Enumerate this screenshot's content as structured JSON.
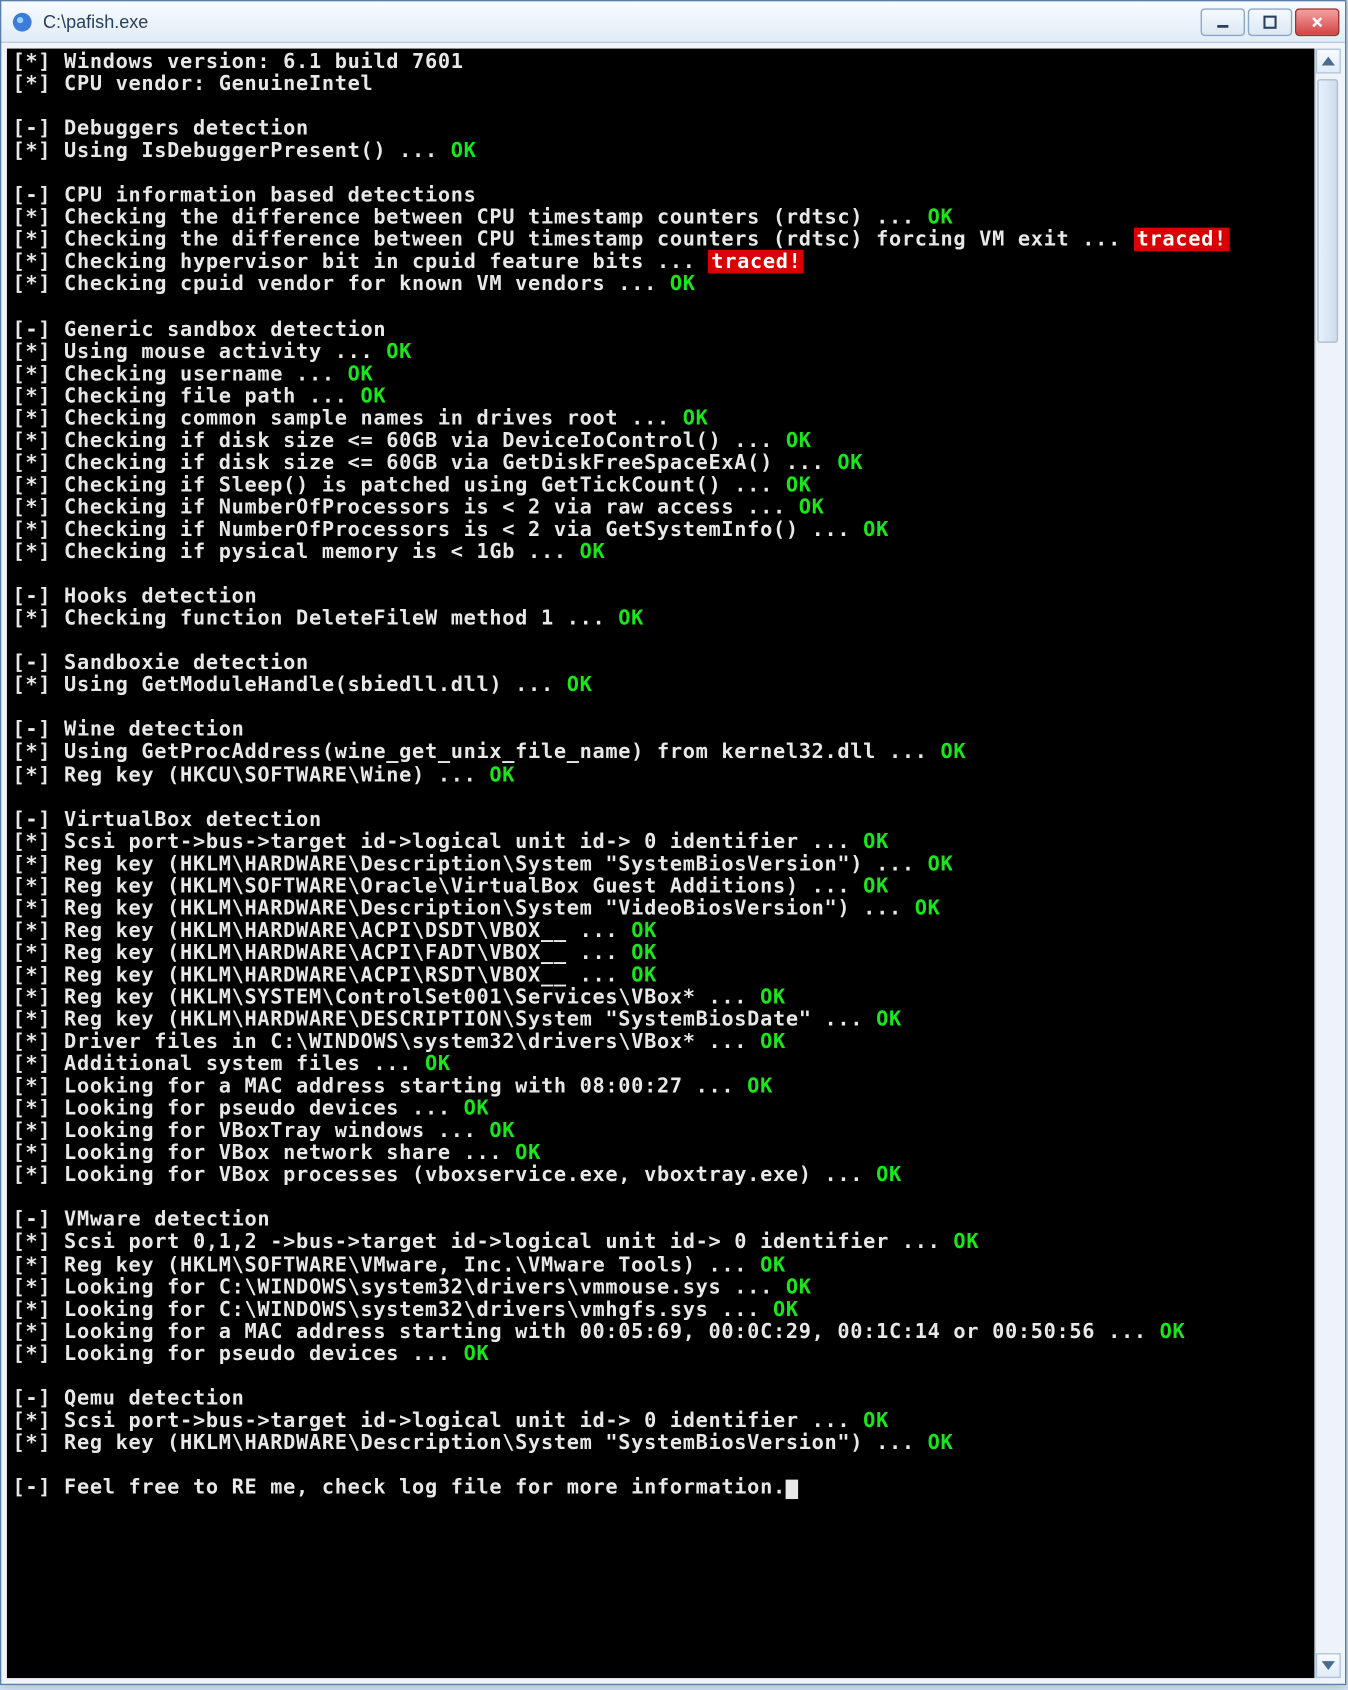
{
  "window": {
    "title": "C:\\pafish.exe"
  },
  "status": {
    "ok": "OK",
    "traced": "traced!"
  },
  "lines": [
    {
      "p": "[*] ",
      "t": "Windows version: 6.1 build 7601"
    },
    {
      "p": "[*] ",
      "t": "CPU vendor: GenuineIntel"
    },
    {
      "blank": true
    },
    {
      "p": "[-] ",
      "t": "Debuggers detection"
    },
    {
      "p": "[*] ",
      "t": "Using IsDebuggerPresent() ... ",
      "s": "ok"
    },
    {
      "blank": true
    },
    {
      "p": "[-] ",
      "t": "CPU information based detections"
    },
    {
      "p": "[*] ",
      "t": "Checking the difference between CPU timestamp counters (rdtsc) ... ",
      "s": "ok"
    },
    {
      "p": "[*] ",
      "t": "Checking the difference between CPU timestamp counters (rdtsc) forcing VM exit ... ",
      "s": "traced"
    },
    {
      "p": "[*] ",
      "t": "Checking hypervisor bit in cpuid feature bits ... ",
      "s": "traced"
    },
    {
      "p": "[*] ",
      "t": "Checking cpuid vendor for known VM vendors ... ",
      "s": "ok"
    },
    {
      "blank": true
    },
    {
      "p": "[-] ",
      "t": "Generic sandbox detection"
    },
    {
      "p": "[*] ",
      "t": "Using mouse activity ... ",
      "s": "ok"
    },
    {
      "p": "[*] ",
      "t": "Checking username ... ",
      "s": "ok"
    },
    {
      "p": "[*] ",
      "t": "Checking file path ... ",
      "s": "ok"
    },
    {
      "p": "[*] ",
      "t": "Checking common sample names in drives root ... ",
      "s": "ok"
    },
    {
      "p": "[*] ",
      "t": "Checking if disk size <= 60GB via DeviceIoControl() ... ",
      "s": "ok"
    },
    {
      "p": "[*] ",
      "t": "Checking if disk size <= 60GB via GetDiskFreeSpaceExA() ... ",
      "s": "ok"
    },
    {
      "p": "[*] ",
      "t": "Checking if Sleep() is patched using GetTickCount() ... ",
      "s": "ok"
    },
    {
      "p": "[*] ",
      "t": "Checking if NumberOfProcessors is < 2 via raw access ... ",
      "s": "ok"
    },
    {
      "p": "[*] ",
      "t": "Checking if NumberOfProcessors is < 2 via GetSystemInfo() ... ",
      "s": "ok"
    },
    {
      "p": "[*] ",
      "t": "Checking if pysical memory is < 1Gb ... ",
      "s": "ok"
    },
    {
      "blank": true
    },
    {
      "p": "[-] ",
      "t": "Hooks detection"
    },
    {
      "p": "[*] ",
      "t": "Checking function DeleteFileW method 1 ... ",
      "s": "ok"
    },
    {
      "blank": true
    },
    {
      "p": "[-] ",
      "t": "Sandboxie detection"
    },
    {
      "p": "[*] ",
      "t": "Using GetModuleHandle(sbiedll.dll) ... ",
      "s": "ok"
    },
    {
      "blank": true
    },
    {
      "p": "[-] ",
      "t": "Wine detection"
    },
    {
      "p": "[*] ",
      "t": "Using GetProcAddress(wine_get_unix_file_name) from kernel32.dll ... ",
      "s": "ok"
    },
    {
      "p": "[*] ",
      "t": "Reg key (HKCU\\SOFTWARE\\Wine) ... ",
      "s": "ok"
    },
    {
      "blank": true
    },
    {
      "p": "[-] ",
      "t": "VirtualBox detection"
    },
    {
      "p": "[*] ",
      "t": "Scsi port->bus->target id->logical unit id-> 0 identifier ... ",
      "s": "ok"
    },
    {
      "p": "[*] ",
      "t": "Reg key (HKLM\\HARDWARE\\Description\\System \"SystemBiosVersion\") ... ",
      "s": "ok"
    },
    {
      "p": "[*] ",
      "t": "Reg key (HKLM\\SOFTWARE\\Oracle\\VirtualBox Guest Additions) ... ",
      "s": "ok"
    },
    {
      "p": "[*] ",
      "t": "Reg key (HKLM\\HARDWARE\\Description\\System \"VideoBiosVersion\") ... ",
      "s": "ok"
    },
    {
      "p": "[*] ",
      "t": "Reg key (HKLM\\HARDWARE\\ACPI\\DSDT\\VBOX__ ... ",
      "s": "ok"
    },
    {
      "p": "[*] ",
      "t": "Reg key (HKLM\\HARDWARE\\ACPI\\FADT\\VBOX__ ... ",
      "s": "ok"
    },
    {
      "p": "[*] ",
      "t": "Reg key (HKLM\\HARDWARE\\ACPI\\RSDT\\VBOX__ ... ",
      "s": "ok"
    },
    {
      "p": "[*] ",
      "t": "Reg key (HKLM\\SYSTEM\\ControlSet001\\Services\\VBox* ... ",
      "s": "ok"
    },
    {
      "p": "[*] ",
      "t": "Reg key (HKLM\\HARDWARE\\DESCRIPTION\\System \"SystemBiosDate\" ... ",
      "s": "ok"
    },
    {
      "p": "[*] ",
      "t": "Driver files in C:\\WINDOWS\\system32\\drivers\\VBox* ... ",
      "s": "ok"
    },
    {
      "p": "[*] ",
      "t": "Additional system files ... ",
      "s": "ok"
    },
    {
      "p": "[*] ",
      "t": "Looking for a MAC address starting with 08:00:27 ... ",
      "s": "ok"
    },
    {
      "p": "[*] ",
      "t": "Looking for pseudo devices ... ",
      "s": "ok"
    },
    {
      "p": "[*] ",
      "t": "Looking for VBoxTray windows ... ",
      "s": "ok"
    },
    {
      "p": "[*] ",
      "t": "Looking for VBox network share ... ",
      "s": "ok"
    },
    {
      "p": "[*] ",
      "t": "Looking for VBox processes (vboxservice.exe, vboxtray.exe) ... ",
      "s": "ok"
    },
    {
      "blank": true
    },
    {
      "p": "[-] ",
      "t": "VMware detection"
    },
    {
      "p": "[*] ",
      "t": "Scsi port 0,1,2 ->bus->target id->logical unit id-> 0 identifier ... ",
      "s": "ok"
    },
    {
      "p": "[*] ",
      "t": "Reg key (HKLM\\SOFTWARE\\VMware, Inc.\\VMware Tools) ... ",
      "s": "ok"
    },
    {
      "p": "[*] ",
      "t": "Looking for C:\\WINDOWS\\system32\\drivers\\vmmouse.sys ... ",
      "s": "ok"
    },
    {
      "p": "[*] ",
      "t": "Looking for C:\\WINDOWS\\system32\\drivers\\vmhgfs.sys ... ",
      "s": "ok"
    },
    {
      "p": "[*] ",
      "t": "Looking for a MAC address starting with 00:05:69, 00:0C:29, 00:1C:14 or 00:50:56 ... ",
      "s": "ok"
    },
    {
      "p": "[*] ",
      "t": "Looking for pseudo devices ... ",
      "s": "ok"
    },
    {
      "blank": true
    },
    {
      "p": "[-] ",
      "t": "Qemu detection"
    },
    {
      "p": "[*] ",
      "t": "Scsi port->bus->target id->logical unit id-> 0 identifier ... ",
      "s": "ok"
    },
    {
      "p": "[*] ",
      "t": "Reg key (HKLM\\HARDWARE\\Description\\System \"SystemBiosVersion\") ... ",
      "s": "ok"
    },
    {
      "blank": true
    },
    {
      "p": "[-] ",
      "t": "Feel free to RE me, check log file for more information.",
      "cursor": true
    }
  ]
}
